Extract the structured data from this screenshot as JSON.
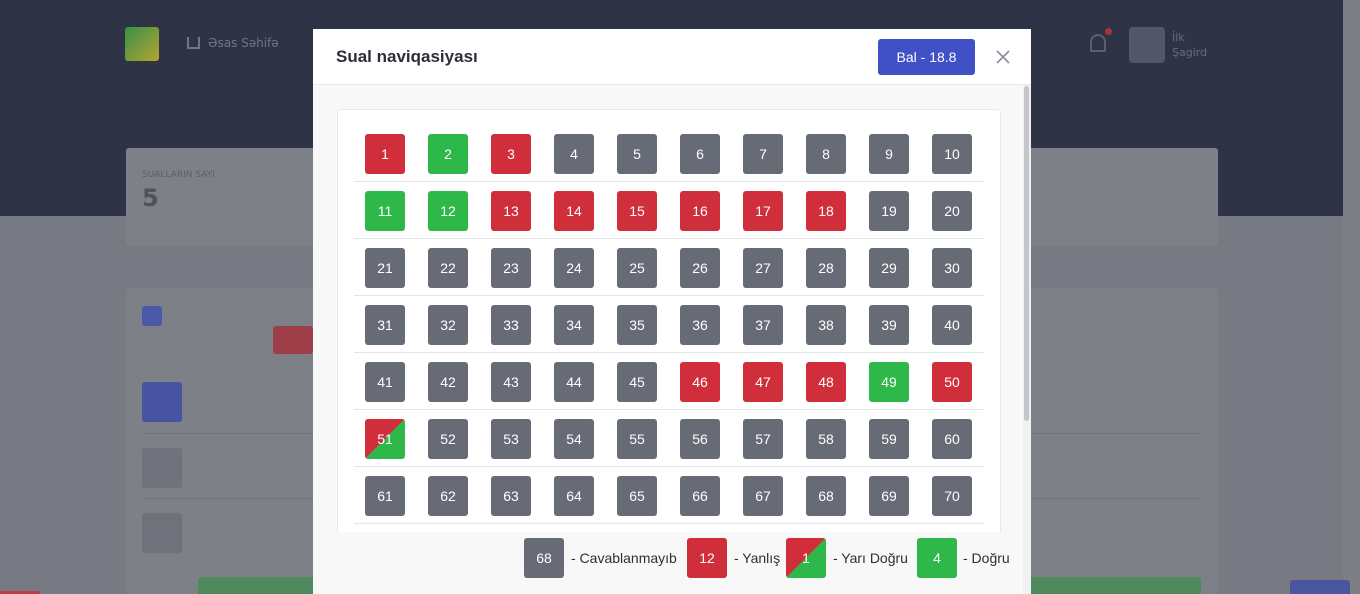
{
  "background": {
    "nav_home_label": "Əsas Səhifə",
    "user_name": "İlk",
    "user_role": "Şagird",
    "stat_label": "SUALLARIN SAYI",
    "stat_value": "5"
  },
  "modal": {
    "title": "Sual naviqasiyası",
    "score_label": "Bal - 18.8",
    "close_icon": "close-icon",
    "questions": [
      {
        "number": "1",
        "status": "wrong"
      },
      {
        "number": "2",
        "status": "correct"
      },
      {
        "number": "3",
        "status": "wrong"
      },
      {
        "number": "4",
        "status": "unanswered"
      },
      {
        "number": "5",
        "status": "unanswered"
      },
      {
        "number": "6",
        "status": "unanswered"
      },
      {
        "number": "7",
        "status": "unanswered"
      },
      {
        "number": "8",
        "status": "unanswered"
      },
      {
        "number": "9",
        "status": "unanswered"
      },
      {
        "number": "10",
        "status": "unanswered"
      },
      {
        "number": "11",
        "status": "correct"
      },
      {
        "number": "12",
        "status": "correct"
      },
      {
        "number": "13",
        "status": "wrong"
      },
      {
        "number": "14",
        "status": "wrong"
      },
      {
        "number": "15",
        "status": "wrong"
      },
      {
        "number": "16",
        "status": "wrong"
      },
      {
        "number": "17",
        "status": "wrong"
      },
      {
        "number": "18",
        "status": "wrong"
      },
      {
        "number": "19",
        "status": "unanswered"
      },
      {
        "number": "20",
        "status": "unanswered"
      },
      {
        "number": "21",
        "status": "unanswered"
      },
      {
        "number": "22",
        "status": "unanswered"
      },
      {
        "number": "23",
        "status": "unanswered"
      },
      {
        "number": "24",
        "status": "unanswered"
      },
      {
        "number": "25",
        "status": "unanswered"
      },
      {
        "number": "26",
        "status": "unanswered"
      },
      {
        "number": "27",
        "status": "unanswered"
      },
      {
        "number": "28",
        "status": "unanswered"
      },
      {
        "number": "29",
        "status": "unanswered"
      },
      {
        "number": "30",
        "status": "unanswered"
      },
      {
        "number": "31",
        "status": "unanswered"
      },
      {
        "number": "32",
        "status": "unanswered"
      },
      {
        "number": "33",
        "status": "unanswered"
      },
      {
        "number": "34",
        "status": "unanswered"
      },
      {
        "number": "35",
        "status": "unanswered"
      },
      {
        "number": "36",
        "status": "unanswered"
      },
      {
        "number": "37",
        "status": "unanswered"
      },
      {
        "number": "38",
        "status": "unanswered"
      },
      {
        "number": "39",
        "status": "unanswered"
      },
      {
        "number": "40",
        "status": "unanswered"
      },
      {
        "number": "41",
        "status": "unanswered"
      },
      {
        "number": "42",
        "status": "unanswered"
      },
      {
        "number": "43",
        "status": "unanswered"
      },
      {
        "number": "44",
        "status": "unanswered"
      },
      {
        "number": "45",
        "status": "unanswered"
      },
      {
        "number": "46",
        "status": "wrong"
      },
      {
        "number": "47",
        "status": "wrong"
      },
      {
        "number": "48",
        "status": "wrong"
      },
      {
        "number": "49",
        "status": "correct"
      },
      {
        "number": "50",
        "status": "wrong"
      },
      {
        "number": "51",
        "status": "half"
      },
      {
        "number": "52",
        "status": "unanswered"
      },
      {
        "number": "53",
        "status": "unanswered"
      },
      {
        "number": "54",
        "status": "unanswered"
      },
      {
        "number": "55",
        "status": "unanswered"
      },
      {
        "number": "56",
        "status": "unanswered"
      },
      {
        "number": "57",
        "status": "unanswered"
      },
      {
        "number": "58",
        "status": "unanswered"
      },
      {
        "number": "59",
        "status": "unanswered"
      },
      {
        "number": "60",
        "status": "unanswered"
      },
      {
        "number": "61",
        "status": "unanswered"
      },
      {
        "number": "62",
        "status": "unanswered"
      },
      {
        "number": "63",
        "status": "unanswered"
      },
      {
        "number": "64",
        "status": "unanswered"
      },
      {
        "number": "65",
        "status": "unanswered"
      },
      {
        "number": "66",
        "status": "unanswered"
      },
      {
        "number": "67",
        "status": "unanswered"
      },
      {
        "number": "68",
        "status": "unanswered"
      },
      {
        "number": "69",
        "status": "unanswered"
      },
      {
        "number": "70",
        "status": "unanswered"
      }
    ],
    "legend": [
      {
        "status": "unanswered",
        "count": "68",
        "label": "- Cavablanmayıb"
      },
      {
        "status": "wrong",
        "count": "12",
        "label": "- Yanlış"
      },
      {
        "status": "half",
        "count": "1",
        "label": "- Yarı Doğru"
      },
      {
        "status": "correct",
        "count": "4",
        "label": "- Doğru"
      }
    ],
    "colors": {
      "unanswered": "#676b75",
      "wrong": "#d12e3c",
      "correct": "#2eb84a",
      "accent": "#3f51c4"
    }
  }
}
